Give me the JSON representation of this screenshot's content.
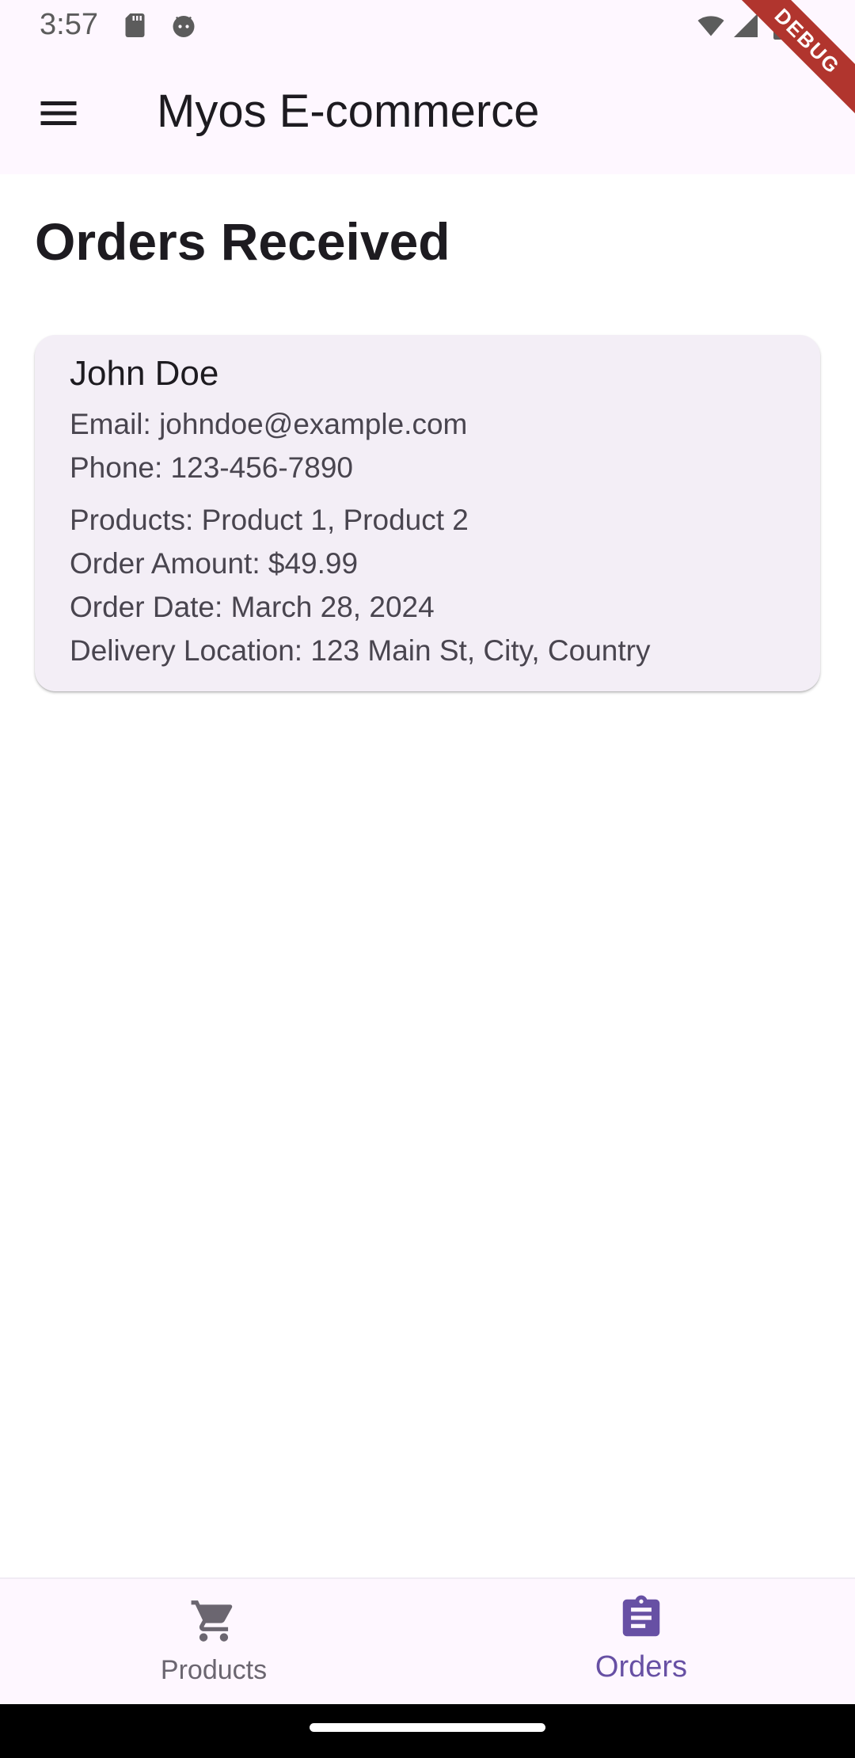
{
  "status_bar": {
    "time": "3:57",
    "icons": [
      "sd-card-icon",
      "android-face-icon",
      "wifi-icon",
      "cellular-signal-icon",
      "battery-icon"
    ]
  },
  "debug_banner": {
    "label": "DEBUG"
  },
  "app_bar": {
    "title": "Myos E-commerce",
    "menu_icon": "menu-icon",
    "background": "#fef7ff"
  },
  "page": {
    "title": "Orders Received"
  },
  "orders": [
    {
      "customer_name": "John Doe",
      "email_line": "Email: johndoe@example.com",
      "phone_line": "Phone: 123-456-7890",
      "products_line": "Products: Product 1, Product 2",
      "amount_line": "Order Amount: $49.99",
      "date_line": "Order Date: March 28, 2024",
      "location_line": "Delivery Location: 123 Main St, City, Country"
    }
  ],
  "bottom_nav": {
    "items": [
      {
        "label": "Products",
        "icon": "shopping-cart-icon",
        "selected": false
      },
      {
        "label": "Orders",
        "icon": "clipboard-icon",
        "selected": true
      }
    ],
    "selected_color": "#6750a4",
    "unselected_color": "#6b6670"
  },
  "colors": {
    "card_background": "#f3eef6",
    "debug_banner": "#b1352e"
  }
}
